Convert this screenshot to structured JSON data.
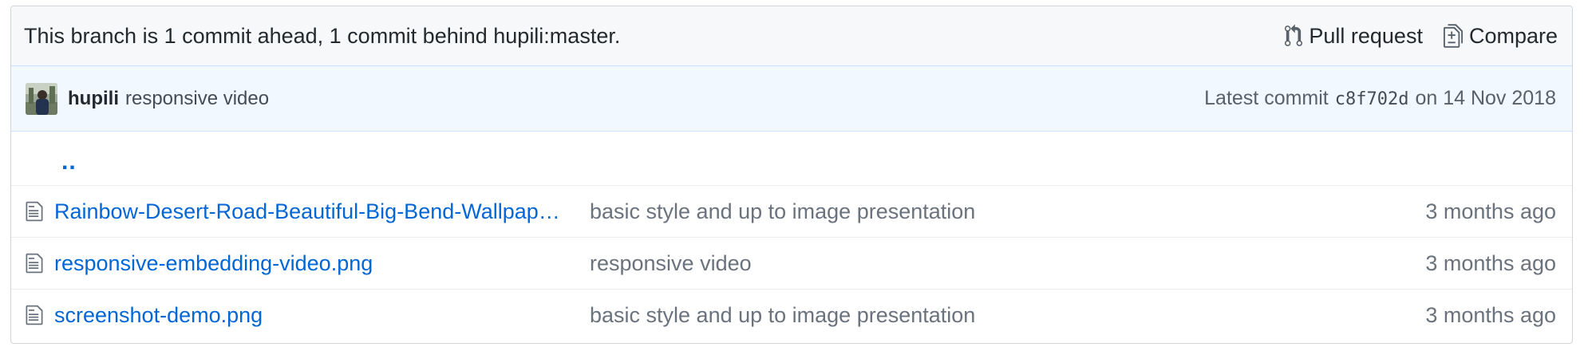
{
  "branch_bar": {
    "text": "This branch is 1 commit ahead, 1 commit behind hupili:master.",
    "pull_request_label": "Pull request",
    "pull_request_icon": "git-pull-request-icon",
    "compare_label": "Compare",
    "compare_icon": "file-diff-icon"
  },
  "commit_bar": {
    "avatar_icon": "avatar",
    "author": "hupili",
    "message": "responsive video",
    "latest_prefix": "Latest commit",
    "sha": "c8f702d",
    "date": "on 14 Nov 2018"
  },
  "up_link": "..",
  "files": [
    {
      "icon": "file-icon",
      "name": "Rainbow-Desert-Road-Beautiful-Big-Bend-Wallpaper-HD.jpg",
      "message": "basic style and up to image presentation",
      "age": "3 months ago"
    },
    {
      "icon": "file-icon",
      "name": "responsive-embedding-video.png",
      "message": "responsive video",
      "age": "3 months ago"
    },
    {
      "icon": "file-icon",
      "name": "screenshot-demo.png",
      "message": "basic style and up to image presentation",
      "age": "3 months ago"
    }
  ],
  "colors": {
    "link": "#0366d6",
    "branch_bg": "#f6f8fa",
    "commit_bg": "#f1f8ff",
    "muted": "#6a737d"
  }
}
